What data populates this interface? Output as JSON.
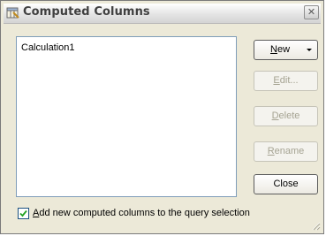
{
  "window": {
    "title": "Computed Columns",
    "close_glyph": "✕"
  },
  "list": {
    "items": [
      "Calculation1"
    ]
  },
  "buttons": {
    "new": {
      "access_key": "N",
      "rest": "ew",
      "enabled": true
    },
    "edit": {
      "access_key": "E",
      "rest": "dit...",
      "enabled": false
    },
    "delete": {
      "access_key": "D",
      "rest": "elete",
      "enabled": false
    },
    "rename": {
      "access_key": "R",
      "rest": "ename",
      "enabled": false
    },
    "close": {
      "label": "Close",
      "enabled": true
    }
  },
  "option": {
    "checked": true,
    "label_prefix": "",
    "access_key": "A",
    "label_rest": "dd new computed columns to the query selection"
  },
  "colors": {
    "dialog_bg": "#ece9d8",
    "list_border": "#7f9db9",
    "disabled_text": "#a5a392"
  },
  "icons": {
    "title": "computed-columns-icon",
    "close": "close-icon",
    "dropdown": "chevron-down-icon",
    "check": "checkmark-icon",
    "grip": "resize-grip-icon"
  }
}
